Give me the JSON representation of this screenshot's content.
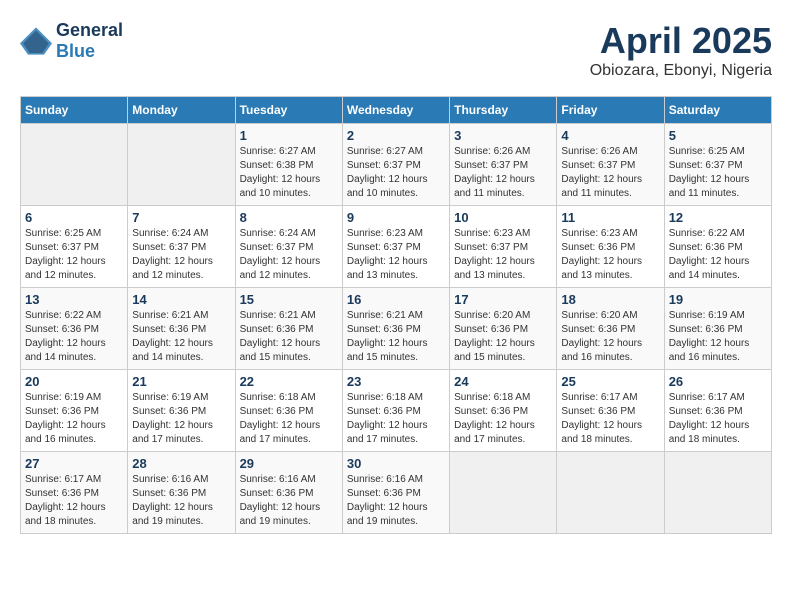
{
  "header": {
    "logo_line1": "General",
    "logo_line2": "Blue",
    "title": "April 2025",
    "subtitle": "Obiozara, Ebonyi, Nigeria"
  },
  "calendar": {
    "days_of_week": [
      "Sunday",
      "Monday",
      "Tuesday",
      "Wednesday",
      "Thursday",
      "Friday",
      "Saturday"
    ],
    "weeks": [
      [
        {
          "day": "",
          "info": ""
        },
        {
          "day": "",
          "info": ""
        },
        {
          "day": "1",
          "info": "Sunrise: 6:27 AM\nSunset: 6:38 PM\nDaylight: 12 hours\nand 10 minutes."
        },
        {
          "day": "2",
          "info": "Sunrise: 6:27 AM\nSunset: 6:37 PM\nDaylight: 12 hours\nand 10 minutes."
        },
        {
          "day": "3",
          "info": "Sunrise: 6:26 AM\nSunset: 6:37 PM\nDaylight: 12 hours\nand 11 minutes."
        },
        {
          "day": "4",
          "info": "Sunrise: 6:26 AM\nSunset: 6:37 PM\nDaylight: 12 hours\nand 11 minutes."
        },
        {
          "day": "5",
          "info": "Sunrise: 6:25 AM\nSunset: 6:37 PM\nDaylight: 12 hours\nand 11 minutes."
        }
      ],
      [
        {
          "day": "6",
          "info": "Sunrise: 6:25 AM\nSunset: 6:37 PM\nDaylight: 12 hours\nand 12 minutes."
        },
        {
          "day": "7",
          "info": "Sunrise: 6:24 AM\nSunset: 6:37 PM\nDaylight: 12 hours\nand 12 minutes."
        },
        {
          "day": "8",
          "info": "Sunrise: 6:24 AM\nSunset: 6:37 PM\nDaylight: 12 hours\nand 12 minutes."
        },
        {
          "day": "9",
          "info": "Sunrise: 6:23 AM\nSunset: 6:37 PM\nDaylight: 12 hours\nand 13 minutes."
        },
        {
          "day": "10",
          "info": "Sunrise: 6:23 AM\nSunset: 6:37 PM\nDaylight: 12 hours\nand 13 minutes."
        },
        {
          "day": "11",
          "info": "Sunrise: 6:23 AM\nSunset: 6:36 PM\nDaylight: 12 hours\nand 13 minutes."
        },
        {
          "day": "12",
          "info": "Sunrise: 6:22 AM\nSunset: 6:36 PM\nDaylight: 12 hours\nand 14 minutes."
        }
      ],
      [
        {
          "day": "13",
          "info": "Sunrise: 6:22 AM\nSunset: 6:36 PM\nDaylight: 12 hours\nand 14 minutes."
        },
        {
          "day": "14",
          "info": "Sunrise: 6:21 AM\nSunset: 6:36 PM\nDaylight: 12 hours\nand 14 minutes."
        },
        {
          "day": "15",
          "info": "Sunrise: 6:21 AM\nSunset: 6:36 PM\nDaylight: 12 hours\nand 15 minutes."
        },
        {
          "day": "16",
          "info": "Sunrise: 6:21 AM\nSunset: 6:36 PM\nDaylight: 12 hours\nand 15 minutes."
        },
        {
          "day": "17",
          "info": "Sunrise: 6:20 AM\nSunset: 6:36 PM\nDaylight: 12 hours\nand 15 minutes."
        },
        {
          "day": "18",
          "info": "Sunrise: 6:20 AM\nSunset: 6:36 PM\nDaylight: 12 hours\nand 16 minutes."
        },
        {
          "day": "19",
          "info": "Sunrise: 6:19 AM\nSunset: 6:36 PM\nDaylight: 12 hours\nand 16 minutes."
        }
      ],
      [
        {
          "day": "20",
          "info": "Sunrise: 6:19 AM\nSunset: 6:36 PM\nDaylight: 12 hours\nand 16 minutes."
        },
        {
          "day": "21",
          "info": "Sunrise: 6:19 AM\nSunset: 6:36 PM\nDaylight: 12 hours\nand 17 minutes."
        },
        {
          "day": "22",
          "info": "Sunrise: 6:18 AM\nSunset: 6:36 PM\nDaylight: 12 hours\nand 17 minutes."
        },
        {
          "day": "23",
          "info": "Sunrise: 6:18 AM\nSunset: 6:36 PM\nDaylight: 12 hours\nand 17 minutes."
        },
        {
          "day": "24",
          "info": "Sunrise: 6:18 AM\nSunset: 6:36 PM\nDaylight: 12 hours\nand 17 minutes."
        },
        {
          "day": "25",
          "info": "Sunrise: 6:17 AM\nSunset: 6:36 PM\nDaylight: 12 hours\nand 18 minutes."
        },
        {
          "day": "26",
          "info": "Sunrise: 6:17 AM\nSunset: 6:36 PM\nDaylight: 12 hours\nand 18 minutes."
        }
      ],
      [
        {
          "day": "27",
          "info": "Sunrise: 6:17 AM\nSunset: 6:36 PM\nDaylight: 12 hours\nand 18 minutes."
        },
        {
          "day": "28",
          "info": "Sunrise: 6:16 AM\nSunset: 6:36 PM\nDaylight: 12 hours\nand 19 minutes."
        },
        {
          "day": "29",
          "info": "Sunrise: 6:16 AM\nSunset: 6:36 PM\nDaylight: 12 hours\nand 19 minutes."
        },
        {
          "day": "30",
          "info": "Sunrise: 6:16 AM\nSunset: 6:36 PM\nDaylight: 12 hours\nand 19 minutes."
        },
        {
          "day": "",
          "info": ""
        },
        {
          "day": "",
          "info": ""
        },
        {
          "day": "",
          "info": ""
        }
      ]
    ]
  }
}
